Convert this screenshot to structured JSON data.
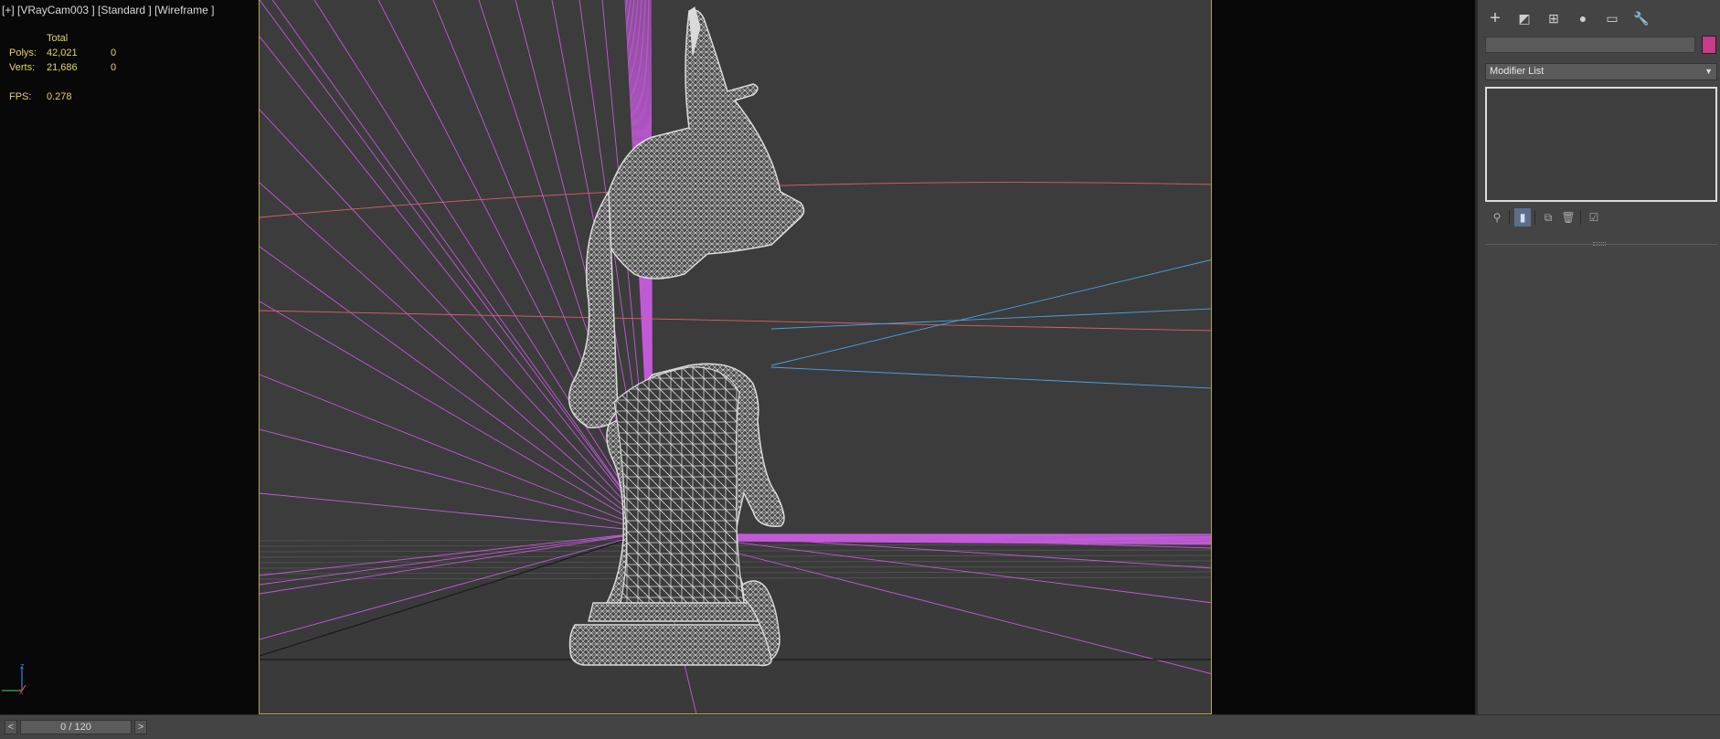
{
  "viewport": {
    "label": "[+] [VRayCam003 ] [Standard ] [Wireframe ]",
    "stats": {
      "total_header": "Total",
      "polys_label": "Polys:",
      "polys_total": "42,021",
      "polys_selected": "0",
      "verts_label": "Verts:",
      "verts_total": "21,686",
      "verts_selected": "0",
      "fps_label": "FPS:",
      "fps_value": "0.278"
    },
    "axis_labels": {
      "z": "z",
      "x": "x"
    }
  },
  "colors": {
    "stats_text": "#e3d36a",
    "safe_frame": "#b6a45a",
    "wire_magenta": "#c25ad8",
    "wire_blue": "#4aa3e8",
    "wire_red": "#d8606a",
    "model_wire": "#dadada",
    "object_color": "#c83a8a"
  },
  "command_panel": {
    "tabs": [
      {
        "name": "create-icon",
        "glyph": "+"
      },
      {
        "name": "modify-icon",
        "glyph": "◩"
      },
      {
        "name": "hierarchy-icon",
        "glyph": "⊞"
      },
      {
        "name": "motion-icon",
        "glyph": "●"
      },
      {
        "name": "display-icon",
        "glyph": "▭"
      },
      {
        "name": "utilities-icon",
        "glyph": "🔧"
      }
    ],
    "object_name": "",
    "modifier_list": "Modifier List",
    "stack_tools": [
      {
        "name": "pin-stack-icon",
        "glyph": "⚲"
      },
      {
        "name": "show-end-result-icon",
        "glyph": "▮"
      },
      {
        "name": "make-unique-icon",
        "glyph": "⧉"
      },
      {
        "name": "remove-modifier-icon",
        "glyph": "🗑"
      },
      {
        "name": "configure-modifier-sets-icon",
        "glyph": "☑"
      }
    ]
  },
  "time_slider": {
    "prev": "<",
    "next": ">",
    "frame_readout": "0 / 120"
  }
}
